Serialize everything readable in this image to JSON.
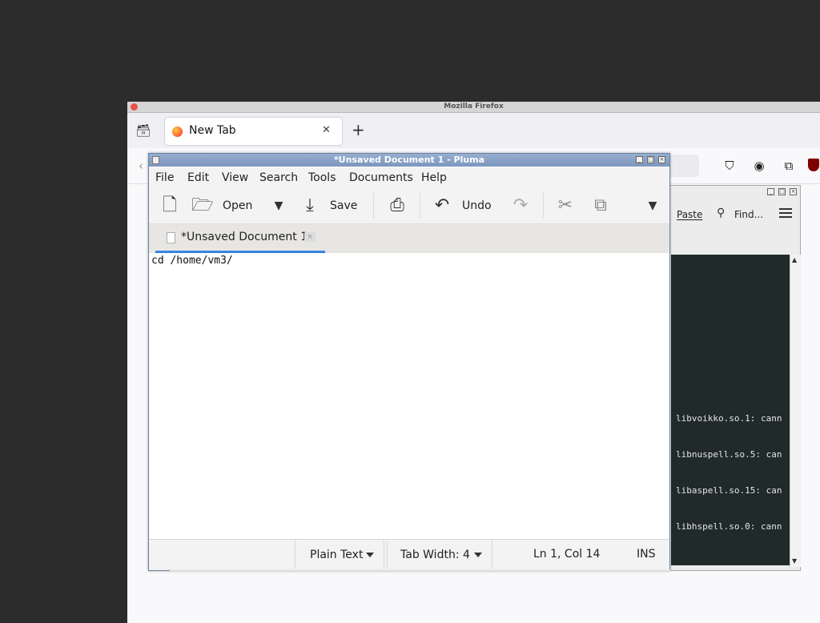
{
  "firefox": {
    "window_title": "Mozilla Firefox",
    "tab": {
      "title": "New Tab",
      "close_glyph": "✕"
    },
    "new_tab_glyph": "+"
  },
  "background_window": {
    "toolbar": {
      "paste_label": "Paste",
      "find_label": "Find..."
    },
    "terminal_lines": [
      "libvoikko.so.1: cann",
      "libnuspell.so.5: can",
      "libaspell.so.15: can",
      "libhspell.so.0: cann"
    ]
  },
  "pluma": {
    "window_title": "*Unsaved Document 1 - Pluma",
    "menu": [
      "File",
      "Edit",
      "View",
      "Search",
      "Tools",
      "Documents",
      "Help"
    ],
    "toolbar": {
      "open_label": "Open",
      "save_label": "Save",
      "undo_label": "Undo"
    },
    "document_tab": {
      "label": "*Unsaved Document 1"
    },
    "editor_text": "cd /home/vm3/",
    "statusbar": {
      "language": "Plain Text",
      "tab_width": "Tab Width:  4",
      "position": "Ln 1, Col 14",
      "mode": "INS"
    }
  },
  "colors": {
    "desktop_bg": "#2c2c2c",
    "pluma_titlebar": "#8aa3c8",
    "tab_indicator": "#3584e4",
    "terminal_bg": "#1f2a29"
  }
}
